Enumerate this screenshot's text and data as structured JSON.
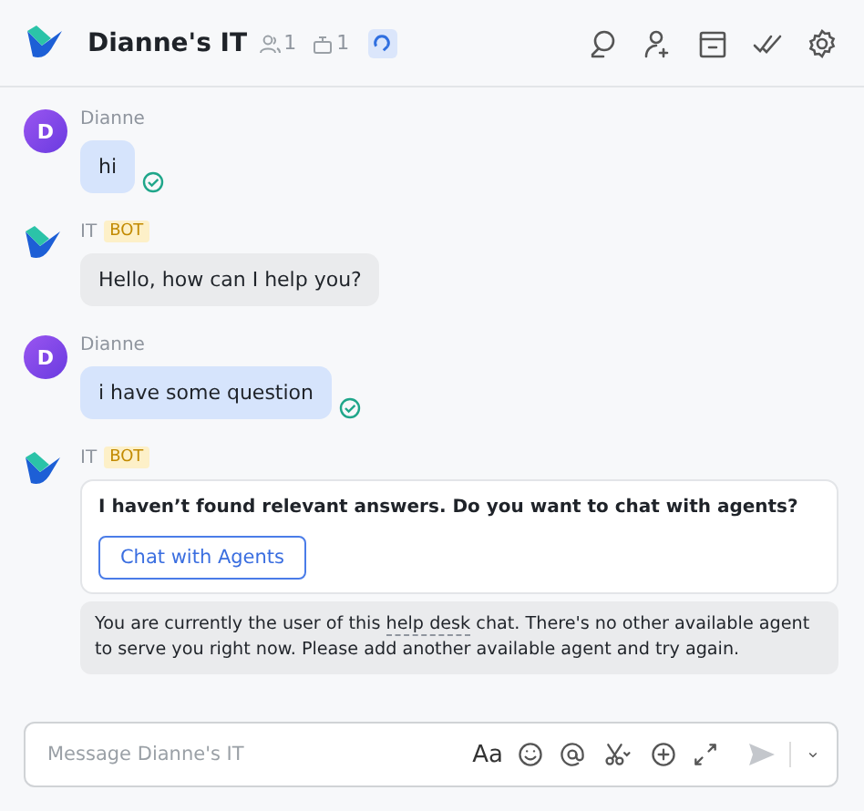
{
  "header": {
    "title": "Dianne's IT",
    "member_count": "1",
    "bot_count": "1"
  },
  "messages": [
    {
      "kind": "user",
      "avatar": "D",
      "sender": "Dianne",
      "text": "hi",
      "read": true
    },
    {
      "kind": "bot",
      "sender": "IT",
      "badge": "BOT",
      "text": "Hello, how can I help you?"
    },
    {
      "kind": "user",
      "avatar": "D",
      "sender": "Dianne",
      "text": "i have some question",
      "read": true
    },
    {
      "kind": "card",
      "sender": "IT",
      "badge": "BOT",
      "title": "I haven’t found relevant answers. Do you want to chat with agents?",
      "button": "Chat with Agents",
      "note_before": "You are currently the user of this ",
      "note_link": "help desk",
      "note_after": " chat. There's no other available agent to serve you right now. Please add another available agent and try again."
    }
  ],
  "composer": {
    "placeholder": "Message Dianne's IT",
    "format_label": "Aa"
  }
}
